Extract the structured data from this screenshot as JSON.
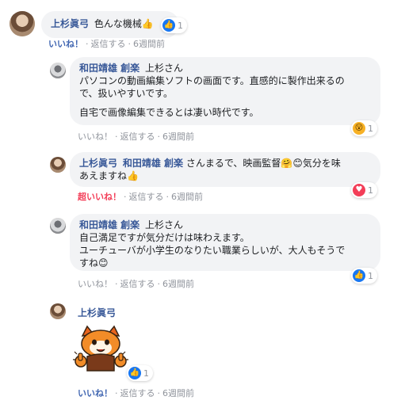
{
  "comments": [
    {
      "author": "上杉眞弓",
      "text": "色んな機械",
      "emoji": "👍",
      "reaction": {
        "type": "like",
        "count": "1"
      },
      "actions": {
        "like": "いいね！",
        "reply": "返信する",
        "time": "6週間前"
      }
    },
    {
      "author": "和田靖雄 創楽",
      "mention": "上杉さん",
      "text_lines": [
        "パソコンの動画編集ソフトの画面です。直感的に製作出来るの",
        "で、扱いやすいです。",
        "",
        "自宅で画像編集できるとは凄い時代です。"
      ],
      "reaction": {
        "type": "wow",
        "count": "1"
      },
      "actions": {
        "like": "いいね！",
        "reply": "返信する",
        "time": "6週間前"
      }
    },
    {
      "author": "上杉眞弓",
      "mention": "和田靖雄 創楽",
      "text_lines": [
        "さんまるで、映画監督",
        "気分を味",
        "あえますね"
      ],
      "emojis": [
        "🤗",
        "😊",
        "👍"
      ],
      "reaction": {
        "type": "love",
        "count": "1"
      },
      "actions": {
        "like": "超いいね！",
        "reply": "返信する",
        "time": "6週間前"
      }
    },
    {
      "author": "和田靖雄 創楽",
      "mention": "上杉さん",
      "text_lines": [
        "自己満足ですが気分だけは味わえます。",
        "ユーチューバが小学生のなりたい職業らしいが、大人もそうで",
        "すね"
      ],
      "emoji": "😊",
      "reaction": {
        "type": "like",
        "count": "1"
      },
      "actions": {
        "like": "いいね！",
        "reply": "返信する",
        "time": "6週間前"
      }
    },
    {
      "author": "上杉眞弓",
      "sticker": "red-panda-thumbs-up-sticker",
      "reaction": {
        "type": "like",
        "count": "1"
      },
      "actions": {
        "like": "いいね！",
        "reply": "返信する",
        "time": "6週間前"
      }
    }
  ],
  "separator": "·",
  "colors": {
    "link": "#385898",
    "bubble": "#f2f3f5",
    "like": "#1877f2",
    "love": "#f33e58"
  }
}
